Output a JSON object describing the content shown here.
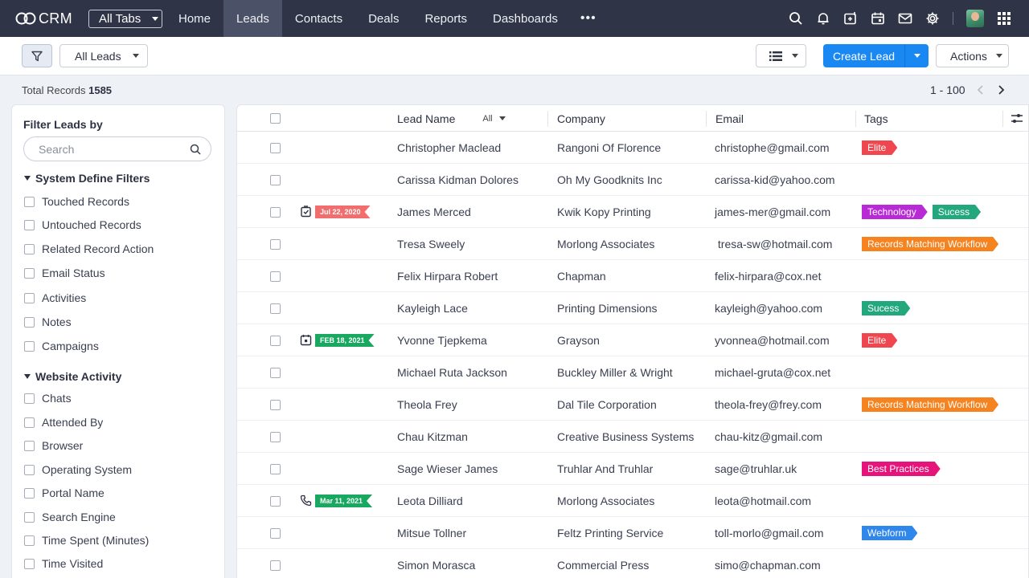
{
  "nav": {
    "logo_text": "CRM",
    "all_tabs": "All Tabs",
    "tabs": [
      {
        "label": "Home"
      },
      {
        "label": "Leads"
      },
      {
        "label": "Contacts"
      },
      {
        "label": "Deals"
      },
      {
        "label": "Reports"
      },
      {
        "label": "Dashboards"
      }
    ],
    "more": "•••",
    "active_tab": "Leads"
  },
  "toolbar": {
    "view_selector": "All Leads",
    "create_label": "Create Lead",
    "actions_label": "Actions"
  },
  "records": {
    "label": "Total Records",
    "count": "1585",
    "page_range": "1 - 100"
  },
  "sidebar": {
    "title": "Filter Leads by",
    "search_placeholder": "Search",
    "system_group": {
      "title": "System Define Filters",
      "items": [
        "Touched Records",
        "Untouched Records",
        "Related Record Action",
        "Email Status",
        "Activities",
        "Notes",
        "Campaigns"
      ]
    },
    "website_group": {
      "title": "Website Activity",
      "items": [
        "Chats",
        "Attended By",
        "Browser",
        "Operating System",
        "Portal Name",
        "Search Engine",
        "Time Spent (Minutes)",
        "Time Visited"
      ]
    }
  },
  "table": {
    "columns": {
      "lead_name": "Lead Name",
      "lead_filter": "All",
      "company": "Company",
      "email": "Email",
      "tags": "Tags"
    },
    "rows": [
      {
        "name": "Christopher Maclead",
        "company": "Rangoni Of Florence",
        "email": "christophe@gmail.com",
        "tags": [
          {
            "label": "Elite",
            "color": "#f0464f"
          }
        ]
      },
      {
        "name": "Carissa Kidman Dolores",
        "company": "Oh My Goodknits Inc",
        "email": "carissa-kid@yahoo.com",
        "tags": []
      },
      {
        "name": "James Merced",
        "company": "Kwik Kopy Printing",
        "email": "james-mer@gmail.com",
        "activity": {
          "icon": "task-check-icon",
          "date": "Jul 22, 2020",
          "color": "#f26d6d"
        },
        "tags": [
          {
            "label": "Technology",
            "color": "#b82ad6"
          },
          {
            "label": "Sucess",
            "color": "#22a87c"
          }
        ]
      },
      {
        "name": "Tresa Sweely",
        "company": "Morlong Associates",
        "email": " tresa-sw@hotmail.com",
        "tags": [
          {
            "label": "Records Matching Workflow",
            "color": "#f5831f"
          }
        ]
      },
      {
        "name": "Felix Hirpara Robert",
        "company": "Chapman",
        "email": "felix-hirpara@cox.net",
        "tags": []
      },
      {
        "name": "Kayleigh Lace",
        "company": "Printing Dimensions",
        "email": "kayleigh@yahoo.com",
        "tags": [
          {
            "label": "Sucess",
            "color": "#22a87c"
          }
        ]
      },
      {
        "name": "Yvonne Tjepkema",
        "company": "Grayson",
        "email": "yvonnea@hotmail.com",
        "activity": {
          "icon": "calendar-event-icon",
          "date": "FEB 18, 2021",
          "color": "#19a85f"
        },
        "tags": [
          {
            "label": "Elite",
            "color": "#f0464f"
          }
        ]
      },
      {
        "name": "Michael Ruta Jackson",
        "company": "Buckley Miller & Wright",
        "email": "michael-gruta@cox.net",
        "tags": []
      },
      {
        "name": "Theola Frey",
        "company": "Dal Tile Corporation",
        "email": "theola-frey@frey.com",
        "tags": [
          {
            "label": "Records Matching Workflow",
            "color": "#f5831f"
          }
        ]
      },
      {
        "name": "Chau Kitzman",
        "company": "Creative Business Systems",
        "email": "chau-kitz@gmail.com",
        "tags": []
      },
      {
        "name": "Sage Wieser James",
        "company": "Truhlar And Truhlar",
        "email": "sage@truhlar.uk",
        "tags": [
          {
            "label": "Best Practices",
            "color": "#e5137a"
          }
        ]
      },
      {
        "name": "Leota Dilliard",
        "company": "Morlong Associates",
        "email": "leota@hotmail.com",
        "activity": {
          "icon": "phone-call-icon",
          "date": "Mar 11, 2021",
          "color": "#19a85f"
        },
        "tags": []
      },
      {
        "name": "Mitsue Tollner",
        "company": "Feltz Printing Service",
        "email": "toll-morlo@gmail.com",
        "tags": [
          {
            "label": "Webform",
            "color": "#2f86eb"
          }
        ]
      },
      {
        "name": "Simon Morasca",
        "company": "Commercial Press",
        "email": "simo@chapman.com",
        "tags": []
      }
    ]
  },
  "colors": {
    "nav_bg": "#2f3447",
    "active_tab_bg": "#4b5166",
    "primary": "#1a88f2",
    "page_bg": "#eef1f6"
  }
}
